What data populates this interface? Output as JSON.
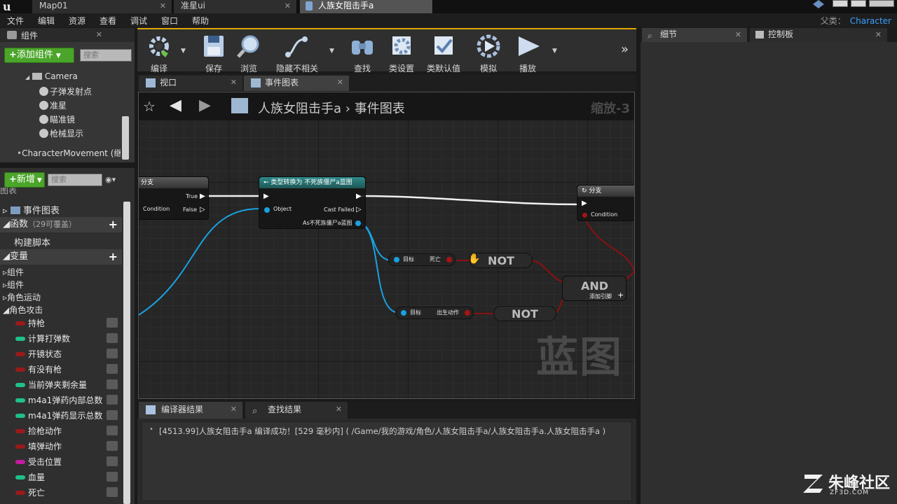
{
  "title_tabs": [
    {
      "label": "Map01"
    },
    {
      "label": "准星ui"
    },
    {
      "label": "人族女阻击手a"
    }
  ],
  "menu": [
    "文件",
    "编辑",
    "资源",
    "查看",
    "调试",
    "窗口",
    "帮助"
  ],
  "parent_class": {
    "label": "父类：",
    "value": "Character"
  },
  "components_panel": {
    "title": "组件",
    "add_button": "添加组件",
    "search_placeholder": "搜索",
    "tree": [
      "Camera",
      "子弹发射点",
      "准星",
      "瞄准镜",
      "枪械显示",
      "CharacterMovement (继"
    ]
  },
  "my_blueprint": {
    "new_button": "新增",
    "search_placeholder": "搜索",
    "cutoff_label": "图表",
    "event_graph": "事件图表",
    "functions": {
      "label": "函数",
      "count": "（29可覆盖）"
    },
    "construction_script": "构建脚本",
    "variables_label": "变量",
    "categories": [
      "组件",
      "组件",
      "角色运动",
      "角色攻击"
    ],
    "variables": [
      {
        "name": "持枪",
        "color": "#9a1a1a"
      },
      {
        "name": "计算打弹数",
        "color": "#20c08a"
      },
      {
        "name": "开镜状态",
        "color": "#9a1a1a"
      },
      {
        "name": "有没有枪",
        "color": "#9a1a1a"
      },
      {
        "name": "当前弹夹剩余量",
        "color": "#20c08a"
      },
      {
        "name": "m4a1弹药内部总数",
        "color": "#20c08a"
      },
      {
        "name": "m4a1弹药显示总数",
        "color": "#20c08a"
      },
      {
        "name": "捡枪动作",
        "color": "#9a1a1a"
      },
      {
        "name": "填弹动作",
        "color": "#9a1a1a"
      },
      {
        "name": "受击位置",
        "color": "#c41aa0"
      },
      {
        "name": "血量",
        "color": "#20c08a"
      },
      {
        "name": "死亡",
        "color": "#9a1a1a"
      }
    ]
  },
  "toolbar": [
    {
      "label": "编译",
      "icon": "compile-gear-icon"
    },
    {
      "label": "保存",
      "icon": "save-disk-icon"
    },
    {
      "label": "浏览",
      "icon": "browse-magnifier-icon"
    },
    {
      "label": "隐藏不相关",
      "icon": "hide-unrelated-icon"
    },
    {
      "label": "查找",
      "icon": "find-binoculars-icon"
    },
    {
      "label": "类设置",
      "icon": "class-settings-icon"
    },
    {
      "label": "类默认值",
      "icon": "class-defaults-icon"
    },
    {
      "label": "模拟",
      "icon": "simulate-icon"
    },
    {
      "label": "播放",
      "icon": "play-icon"
    }
  ],
  "editor_tabs": [
    {
      "label": "视口"
    },
    {
      "label": "事件图表"
    }
  ],
  "graph": {
    "breadcrumb_root": "人族女阻击手a",
    "breadcrumb_sep": "›",
    "breadcrumb_leaf": "事件图表",
    "zoom": "缩放-3",
    "watermark": "蓝图",
    "branch1": {
      "title": "分支",
      "true_pin": "True",
      "false_pin": "False",
      "condition_pin": "Condition"
    },
    "cast_node": {
      "title": "类型转换为 不死族僵尸a蓝图",
      "object_pin": "Object",
      "cast_failed_pin": "Cast Failed",
      "as_pin": "As不死族僵尸a蓝图"
    },
    "branch2": {
      "title": "分支",
      "condition_pin": "Condition"
    },
    "getter1": {
      "target": "目标",
      "value": "死亡"
    },
    "getter2": {
      "target": "目标",
      "value": "出生动作"
    },
    "not1": "NOT",
    "not2": "NOT",
    "and_node": {
      "label": "AND",
      "add_pin": "添加引脚"
    }
  },
  "bottom_tabs": [
    {
      "label": "编译器结果"
    },
    {
      "label": "查找结果"
    }
  ],
  "log_line": "[4513.99]人族女阻击手a 编译成功！[529 毫秒内] ( /Game/我的游戏/角色/人族女阻击手a/人族女阻击手a.人族女阻击手a )",
  "right_tabs": [
    {
      "label": "细节"
    },
    {
      "label": "控制板"
    }
  ],
  "brand": {
    "cn": "朱峰社区",
    "en": "ZF3D.COM"
  }
}
